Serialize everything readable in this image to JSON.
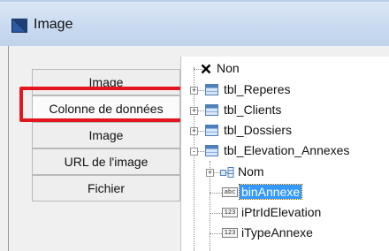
{
  "window": {
    "title": "Image"
  },
  "tabs": [
    {
      "label": "Image"
    },
    {
      "label": "Colonne de données"
    },
    {
      "label": "Image"
    },
    {
      "label": "URL de l'image"
    },
    {
      "label": "Fichier"
    }
  ],
  "tree": {
    "items": [
      {
        "label": "Non",
        "icon": "x-icon"
      },
      {
        "label": "tbl_Reperes",
        "icon": "table-icon",
        "expander": "+"
      },
      {
        "label": "tbl_Clients",
        "icon": "table-icon",
        "expander": "+"
      },
      {
        "label": "tbl_Dossiers",
        "icon": "table-icon",
        "expander": "+"
      },
      {
        "label": "tbl_Elevation_Annexes",
        "icon": "table-icon",
        "expander": "-"
      },
      {
        "label": "Nom",
        "icon": "key-field-icon",
        "expander": "+"
      },
      {
        "label": "binAnnexe",
        "icon": "field-abc-icon",
        "field_icon_text": "abc",
        "selected": true
      },
      {
        "label": "iPtrIdElevation",
        "icon": "field-123-icon",
        "field_icon_text": "123"
      },
      {
        "label": "iTypeAnnexe",
        "icon": "field-123-icon",
        "field_icon_text": "123"
      }
    ]
  },
  "colors": {
    "highlight_border": "#e3161d",
    "selection": "#3399ff",
    "title_bar": "#c9daf0"
  }
}
